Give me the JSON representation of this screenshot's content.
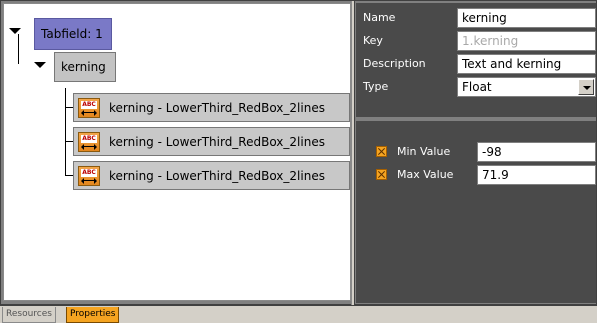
{
  "tree": {
    "root": {
      "label": "Tabfield: 1",
      "expanded": true
    },
    "group": {
      "label": "kerning",
      "expanded": true
    },
    "items": [
      {
        "label": "kerning - LowerThird_RedBox_2lines",
        "icon": "abc-text-icon"
      },
      {
        "label": "kerning - LowerThird_RedBox_2lines",
        "icon": "abc-text-icon"
      },
      {
        "label": "kerning - LowerThird_RedBox_2lines",
        "icon": "abc-text-icon"
      }
    ]
  },
  "properties": {
    "name": {
      "label": "Name",
      "value": "kerning"
    },
    "key": {
      "label": "Key",
      "value": "1.kerning"
    },
    "description": {
      "label": "Description",
      "value": "Text and kerning"
    },
    "type": {
      "label": "Type",
      "value": "Float"
    }
  },
  "limits": {
    "min": {
      "label": "Min Value",
      "value": "-98"
    },
    "max": {
      "label": "Max Value",
      "value": "71.9"
    }
  },
  "tabs": [
    {
      "label": "Resources",
      "active": false
    },
    {
      "label": "Properties",
      "active": true
    }
  ],
  "colors": {
    "root_node": "#7a79c7",
    "panel_background": "#4a4a4a",
    "accent_orange": "#f5a421"
  }
}
